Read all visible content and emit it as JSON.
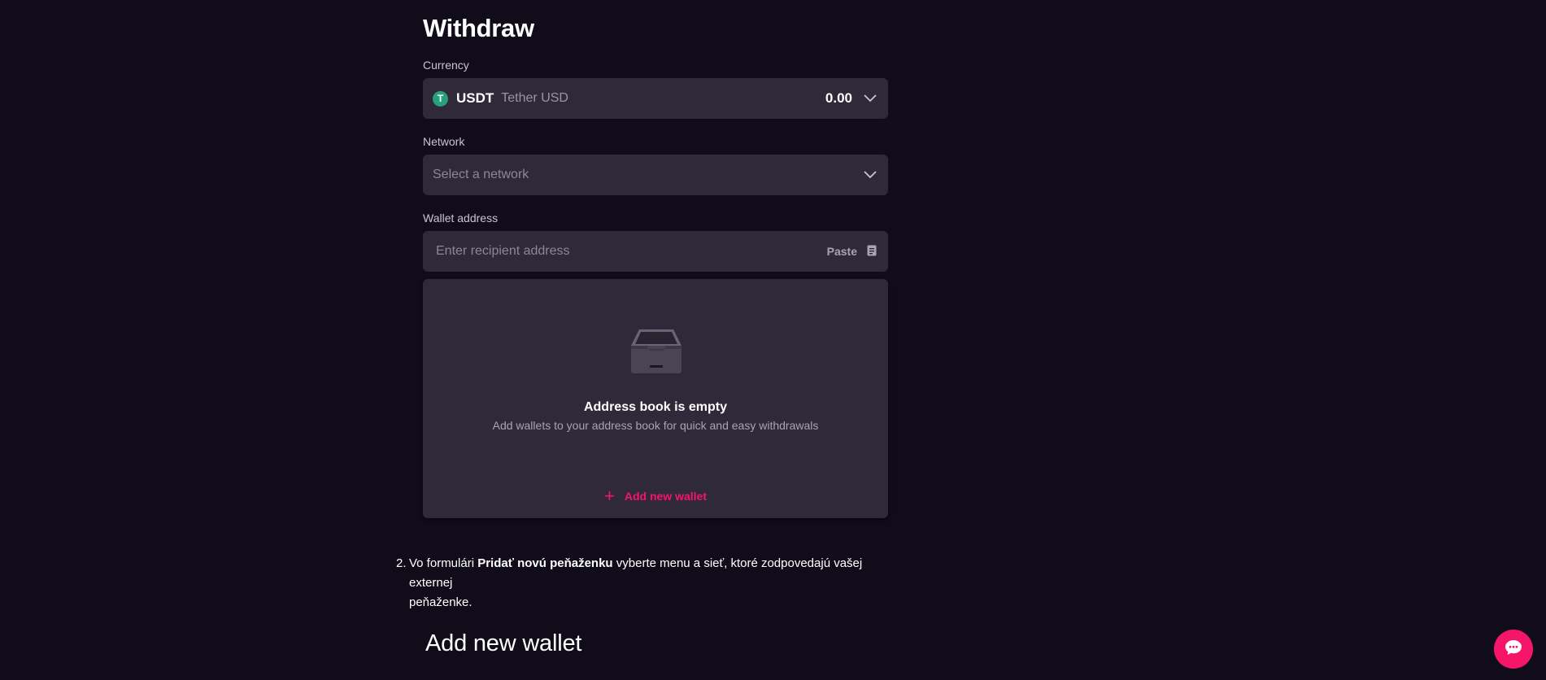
{
  "withdraw": {
    "title": "Withdraw",
    "currency": {
      "label": "Currency",
      "icon": "tether-icon",
      "icon_glyph": "T",
      "symbol": "USDT",
      "name": "Tether USD",
      "balance": "0.00"
    },
    "network": {
      "label": "Network",
      "placeholder": "Select a network"
    },
    "wallet_address": {
      "label": "Wallet address",
      "placeholder": "Enter recipient address",
      "paste_label": "Paste"
    },
    "address_book": {
      "empty_title": "Address book is empty",
      "empty_subtitle": "Add wallets to your address book for quick and easy withdrawals",
      "add_label": "Add new wallet"
    }
  },
  "instruction": {
    "number": "2.",
    "prefix": "Vo formulári ",
    "bold": "Pridať novú peňaženku",
    "suffix": " vyberte menu a sieť, ktoré zodpovedajú vašej externej",
    "line2": "peňaženke."
  },
  "add_wallet_heading": "Add new wallet",
  "colors": {
    "background": "#110c1a",
    "panel": "#302939",
    "accent": "#f5166a",
    "tether": "#26a17b"
  }
}
